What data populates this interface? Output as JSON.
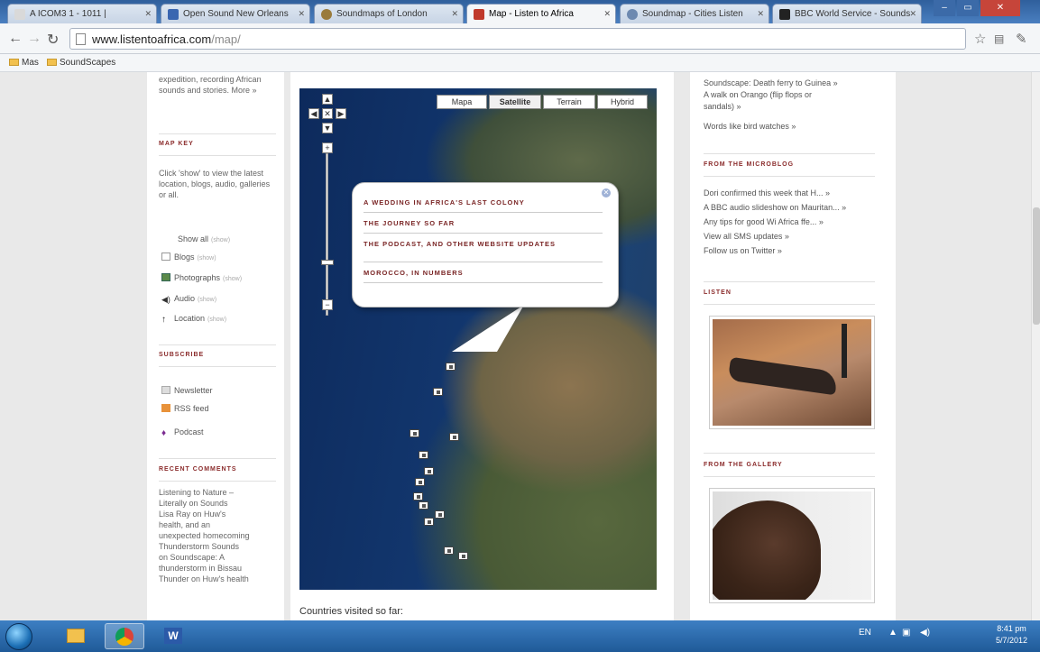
{
  "browser": {
    "tabs": [
      {
        "label": "A ICOM3 1 - 1011 |",
        "active": false
      },
      {
        "label": "Open Sound New Orleans",
        "active": false
      },
      {
        "label": "Soundmaps of London",
        "active": false
      },
      {
        "label": "Map - Listen to Africa",
        "active": true
      },
      {
        "label": "Soundmap - Cities Listen",
        "active": false
      },
      {
        "label": "BBC World Service - Sounds",
        "active": false
      }
    ],
    "url_host": "www.listentoafrica.com",
    "url_path": "/map/",
    "bookmarks": [
      "Mas",
      "SoundScapes"
    ]
  },
  "left_sidebar": {
    "intro_text": "expedition, recording African sounds and stories. More »",
    "map_key": {
      "heading": "MAP KEY",
      "description": "Click 'show' to view the latest location, blogs, audio, galleries or all.",
      "show_all": "Show all",
      "show_all_toggle": "(show)",
      "items": [
        {
          "label": "Blogs",
          "toggle": "(show)",
          "icon": "blog-icon"
        },
        {
          "label": "Photographs",
          "toggle": "(show)",
          "icon": "photo-icon"
        },
        {
          "label": "Audio",
          "toggle": "(show)",
          "icon": "audio-icon"
        },
        {
          "label": "Location",
          "toggle": "(show)",
          "icon": "location-pin-icon"
        }
      ]
    },
    "subscribe": {
      "heading": "SUBSCRIBE",
      "items": [
        {
          "label": "Newsletter",
          "icon": "newsletter-icon"
        },
        {
          "label": "RSS feed",
          "icon": "rss-icon"
        },
        {
          "label": "Podcast",
          "icon": "podcast-icon"
        }
      ]
    },
    "recent_comments": {
      "heading": "RECENT COMMENTS",
      "text_lines": [
        "Listening to Nature –",
        "Literally on Sounds",
        "Lisa Ray on Huw's",
        "health, and an",
        "unexpected homecoming",
        "Thunderstorm Sounds",
        "on Soundscape: A",
        "thunderstorm in Bissau",
        "Thunder on Huw's health"
      ]
    }
  },
  "map": {
    "map_types": [
      "Mapa",
      "Satellite",
      "Terrain",
      "Hybrid"
    ],
    "selected_map_type": "Satellite",
    "zoom_level": 0.66,
    "popup": {
      "items": [
        "A WEDDING IN AFRICA'S LAST COLONY",
        "THE JOURNEY SO FAR",
        "THE PODCAST, AND OTHER WEBSITE UPDATES",
        "MOROCCO, IN NUMBERS"
      ]
    },
    "countries_label": "Countries visited so far:"
  },
  "right_sidebar": {
    "top_links": [
      "Soundscape: Death ferry to Guinea »",
      "A walk on Orango (flip flops or sandals) »",
      "Words like bird watches »"
    ],
    "microblog": {
      "heading": "FROM THE MICROBLOG",
      "links": [
        "Dori confirmed this week that H... »",
        "A BBC audio slideshow on Mauritan... »",
        "Any tips for good Wi Africa ffe... »",
        "View all SMS updates »",
        "Follow us on Twitter »"
      ]
    },
    "listen_heading": "LISTEN",
    "gallery_heading": "FROM THE GALLERY"
  },
  "taskbar": {
    "lang": "EN",
    "time": "8:41 pm",
    "date": "5/7/2012"
  }
}
